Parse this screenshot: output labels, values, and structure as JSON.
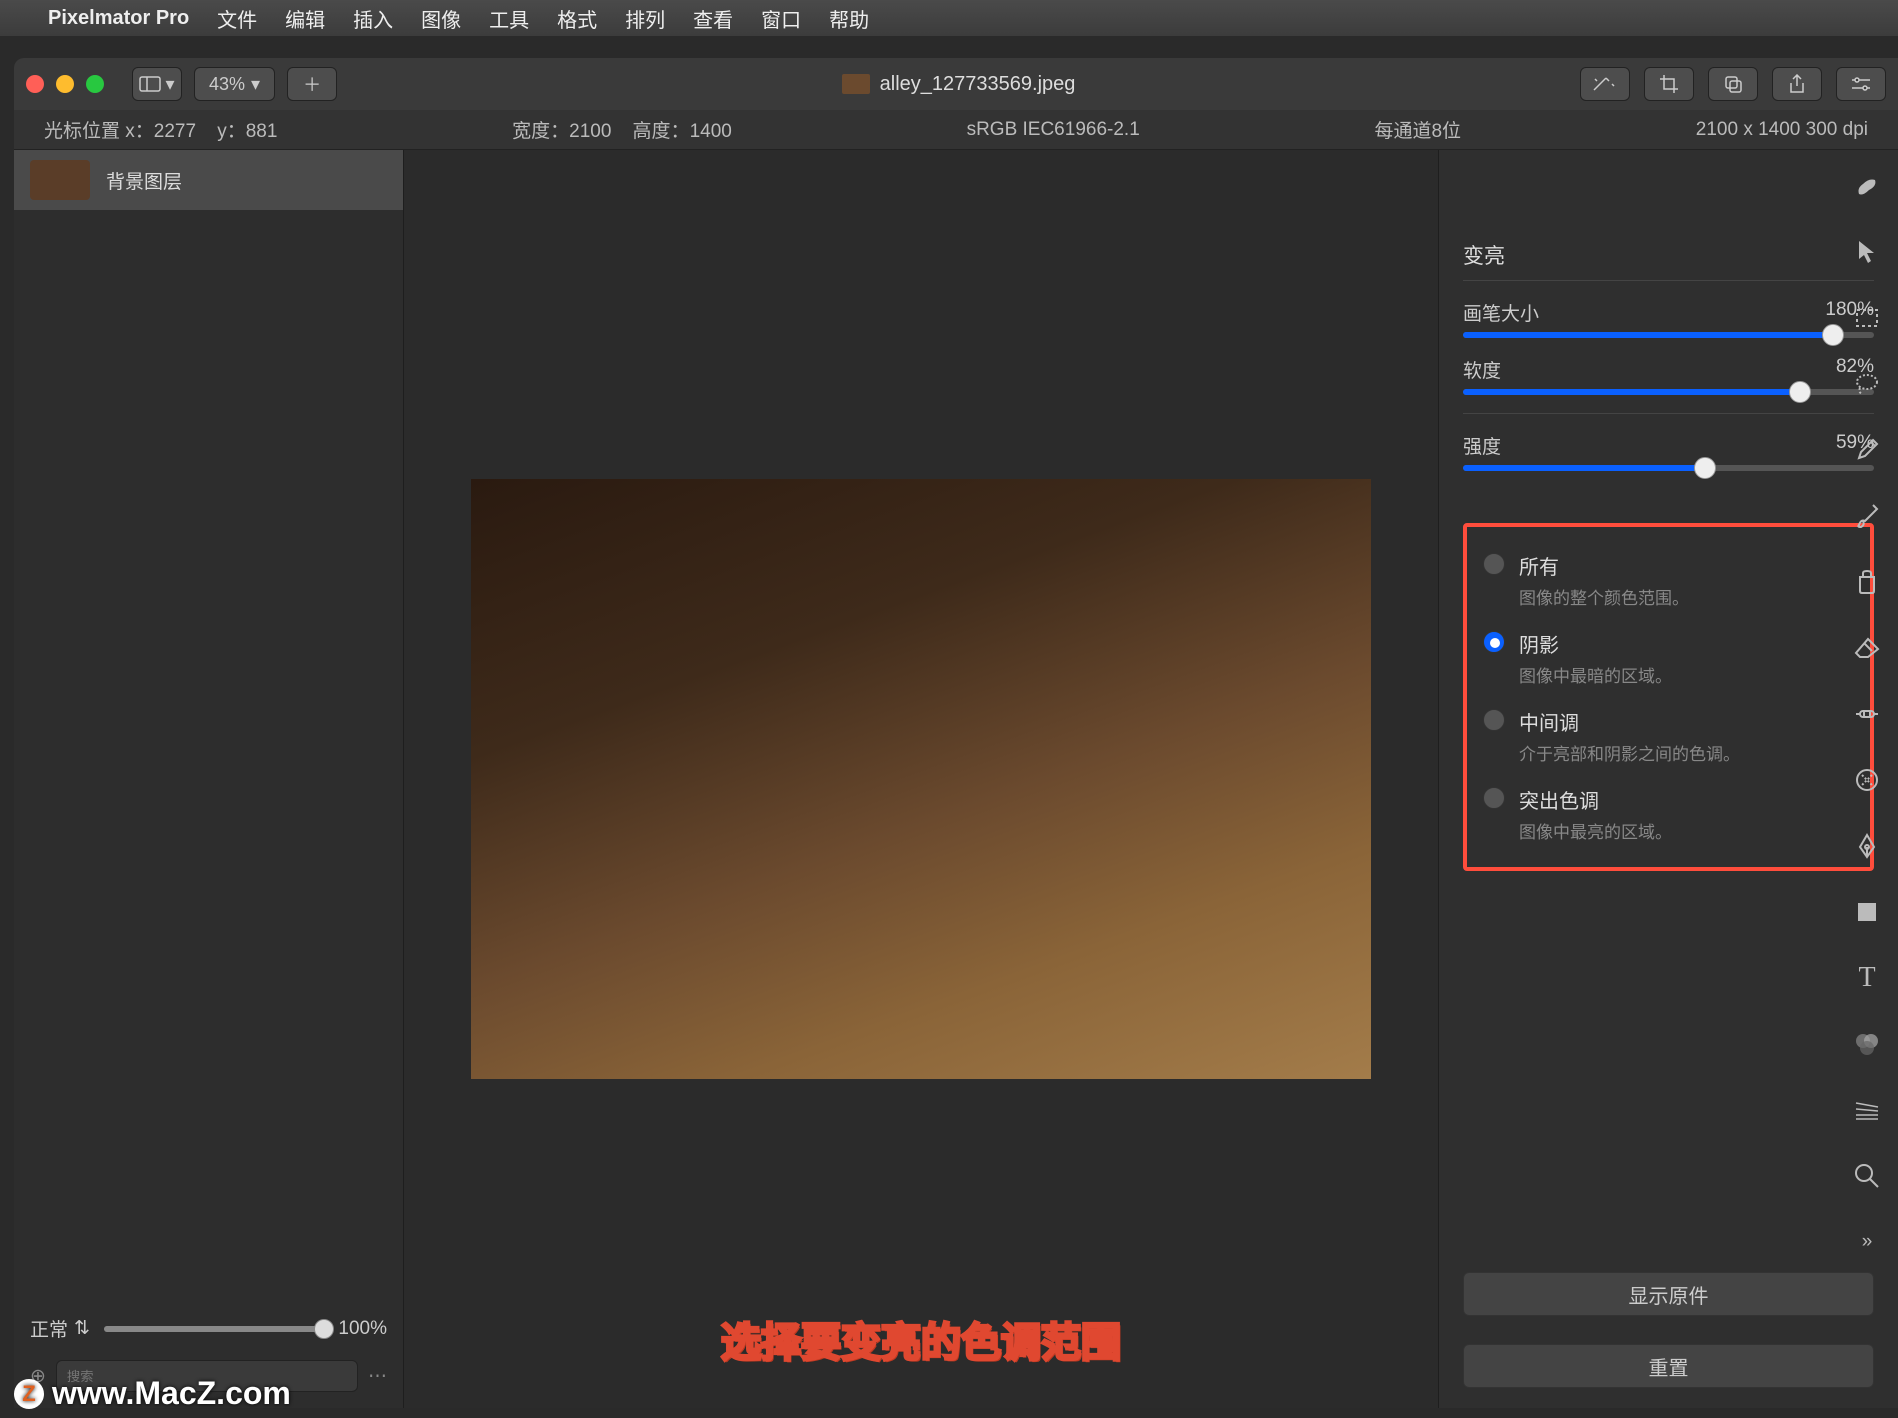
{
  "menubar": {
    "app_name": "Pixelmator Pro",
    "items": [
      "文件",
      "编辑",
      "插入",
      "图像",
      "工具",
      "格式",
      "排列",
      "查看",
      "窗口",
      "帮助"
    ]
  },
  "titlebar": {
    "zoom": "43%",
    "filename": "alley_127733569.jpeg"
  },
  "infobar": {
    "cursor_label": "光标位置 x：",
    "cursor_x": "2277",
    "cursor_y_label": "y：",
    "cursor_y": "881",
    "width_label": "宽度：",
    "width": "2100",
    "height_label": "高度：",
    "height": "1400",
    "colorspace": "sRGB IEC61966-2.1",
    "channel": "每通道8位",
    "dimensions": "2100 x 1400 300 dpi"
  },
  "layers": {
    "items": [
      {
        "name": "背景图层"
      }
    ],
    "blend_mode": "正常",
    "opacity": "100%",
    "search_placeholder": "搜索"
  },
  "canvas": {
    "caption": "选择要变亮的色调范围",
    "watermark": "www.MacZ.com"
  },
  "panel": {
    "title": "变亮",
    "sliders": {
      "brush": {
        "label": "画笔大小",
        "value": "180%",
        "pct": 90
      },
      "softness": {
        "label": "软度",
        "value": "82%",
        "pct": 82
      },
      "strength": {
        "label": "强度",
        "value": "59%",
        "pct": 59
      }
    },
    "tone_options": [
      {
        "label": "所有",
        "desc": "图像的整个颜色范围。",
        "selected": false
      },
      {
        "label": "阴影",
        "desc": "图像中最暗的区域。",
        "selected": true
      },
      {
        "label": "中间调",
        "desc": "介于亮部和阴影之间的色调。",
        "selected": false
      },
      {
        "label": "突出色调",
        "desc": "图像中最亮的区域。",
        "selected": false
      }
    ],
    "buttons": {
      "show_original": "显示原件",
      "reset": "重置"
    }
  },
  "tools": [
    "style-tool",
    "arrow-tool",
    "marquee-tool",
    "lasso-tool",
    "eyedropper-tool",
    "brush-tool",
    "fill-tool",
    "erase-tool",
    "repair-tool",
    "warp-tool",
    "pen-tool",
    "shape-tool",
    "type-tool",
    "color-tool",
    "effects-tool",
    "zoom-tool"
  ]
}
